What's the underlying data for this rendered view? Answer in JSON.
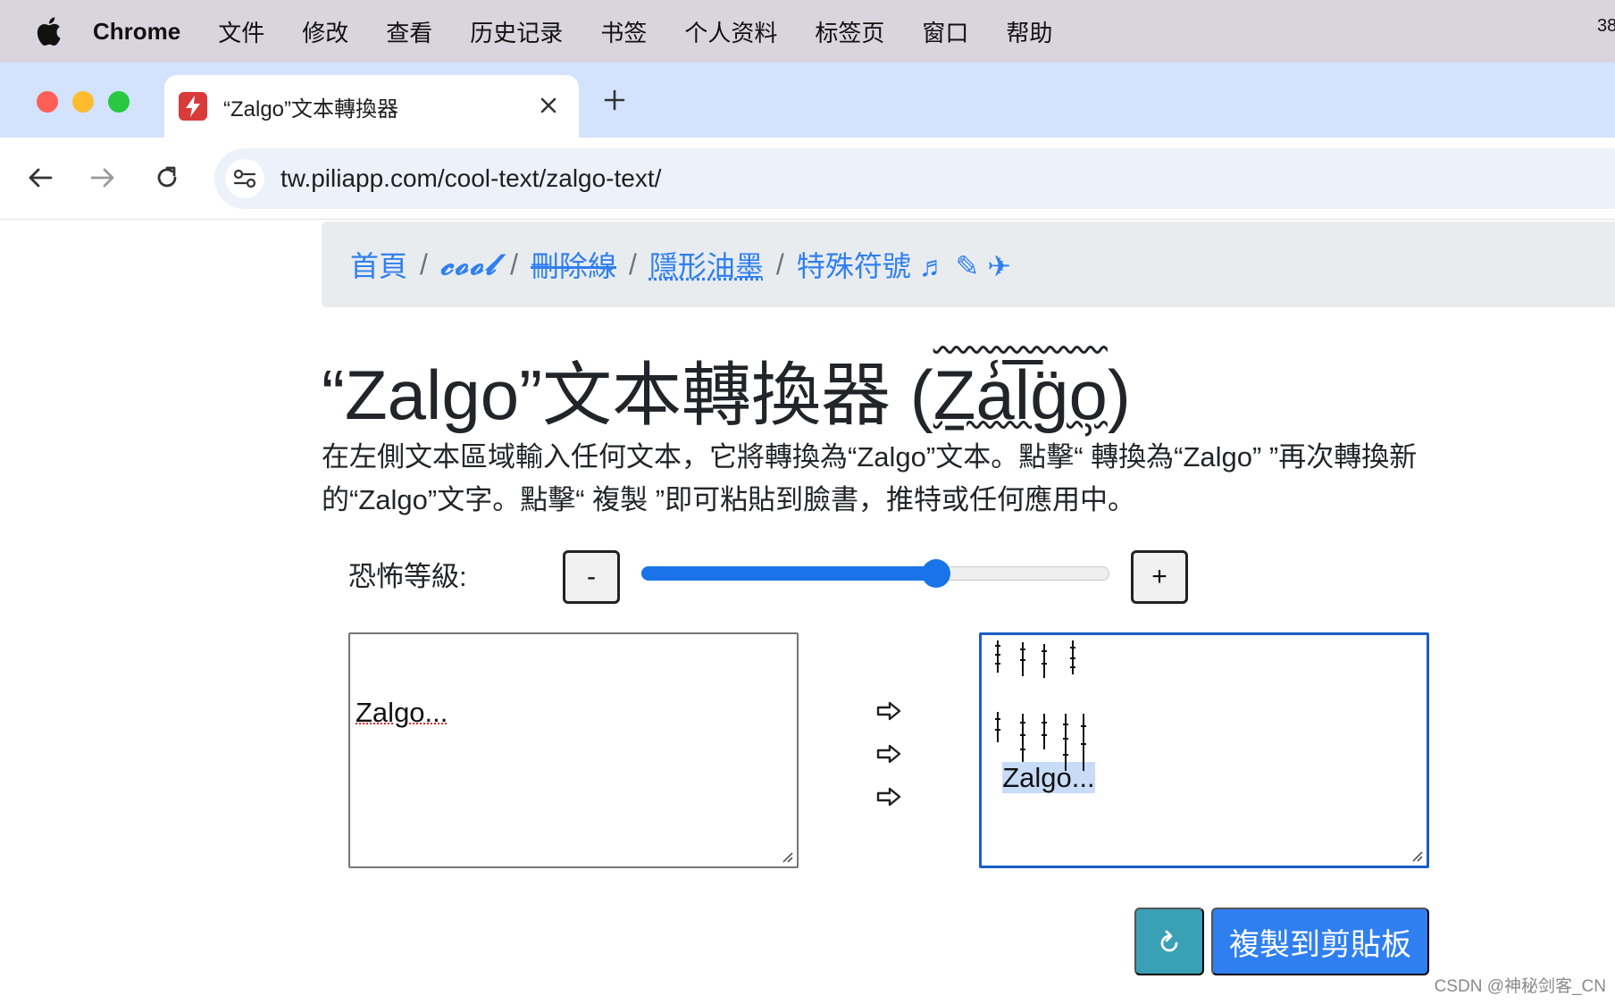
{
  "menubar": {
    "app": "Chrome",
    "items": [
      "文件",
      "修改",
      "查看",
      "历史记录",
      "书签",
      "个人资料",
      "标签页",
      "窗口",
      "帮助"
    ],
    "right": "38"
  },
  "tab": {
    "title": "“Zalgo”文本轉換器"
  },
  "toolbar": {
    "url": "tw.piliapp.com/cool-text/zalgo-text/"
  },
  "breadcrumb": {
    "home": "首頁",
    "sep": "/",
    "cool": "𝓬𝓸𝓸𝓵",
    "strike": "刪除線",
    "hidden": "隱形油墨",
    "special": "特殊符號 ♬ ✎ ✈"
  },
  "main": {
    "title_plain": "“Zalgo”文本轉換器 (",
    "title_zalgo": "Ẕa̾l̅g̈o̹",
    "title_close": ")",
    "description": "在左側文本區域輸入任何文本，它將轉換為“Zalgo”文本。點擊“ 轉換為“Zalgo” ”再次轉換新的“Zalgo”文字。點擊“ 複製 ”即可粘貼到臉書，推特或任何應用中。",
    "level_label": "恐怖等級:",
    "minus_label": "-",
    "plus_label": "+",
    "level": 0.63,
    "input_text": "Zalgo...",
    "output_text": "Zalgo...",
    "copy_label": "複製到剪貼板"
  },
  "watermark": "CSDN @神秘剑客_CN",
  "colors": {
    "primary": "#2f7ff0",
    "info": "#3aa0b5",
    "tab_strip": "#d3e3fd"
  }
}
